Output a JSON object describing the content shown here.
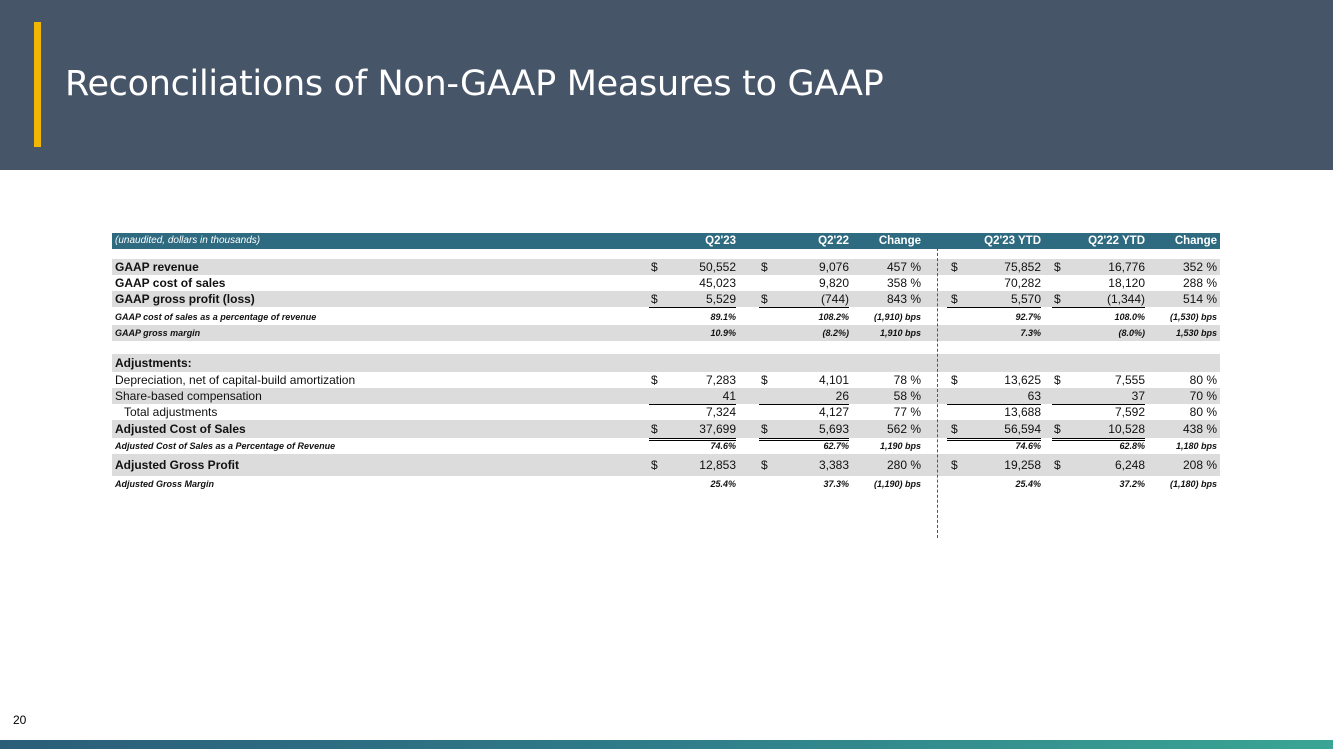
{
  "slide": {
    "title": "Reconciliations of Non-GAAP Measures to GAAP",
    "page_number": "20"
  },
  "table": {
    "note": "(unaudited, dollars in thousands)",
    "headers": [
      "Q2'23",
      "Q2'22",
      "Change",
      "Q2'23 YTD",
      "Q2'22 YTD",
      "Change"
    ],
    "gaap_revenue": {
      "label": "GAAP revenue",
      "d1": "$",
      "q223": "50,552",
      "d2": "$",
      "q222": "9,076",
      "chg": "457 %",
      "d3": "$",
      "ytd23": "75,852",
      "d4": "$",
      "ytd22": "16,776",
      "chg_ytd": "352 %"
    },
    "gaap_cost": {
      "label": "GAAP cost of sales",
      "q223": "45,023",
      "q222": "9,820",
      "chg": "358 %",
      "ytd23": "70,282",
      "ytd22": "18,120",
      "chg_ytd": "288 %"
    },
    "gaap_gp": {
      "label": "GAAP gross profit (loss)",
      "d1": "$",
      "q223": "5,529",
      "d2": "$",
      "q222": "(744)",
      "chg": "843 %",
      "d3": "$",
      "ytd23": "5,570",
      "d4": "$",
      "ytd22": "(1,344)",
      "chg_ytd": "514 %"
    },
    "gaap_cost_pct": {
      "label": "GAAP cost of sales as a percentage of revenue",
      "q223": "89.1%",
      "q222": "108.2%",
      "chg": "(1,910) bps",
      "ytd23": "92.7%",
      "ytd22": "108.0%",
      "chg_ytd": "(1,530) bps"
    },
    "gaap_gm": {
      "label": "GAAP gross margin",
      "q223": "10.9%",
      "q222": "(8.2%)",
      "chg": "1,910  bps",
      "ytd23": "7.3%",
      "ytd22": "(8.0%)",
      "chg_ytd": "1,530  bps"
    },
    "adjustments_label": "Adjustments:",
    "depreciation": {
      "label": "Depreciation, net of capital-build amortization",
      "d1": "$",
      "q223": "7,283",
      "d2": "$",
      "q222": "4,101",
      "chg": "78 %",
      "d3": "$",
      "ytd23": "13,625",
      "d4": "$",
      "ytd22": "7,555",
      "chg_ytd": "80 %"
    },
    "sbc": {
      "label": "Share-based compensation",
      "q223": "41",
      "q222": "26",
      "chg": "58 %",
      "ytd23": "63",
      "ytd22": "37",
      "chg_ytd": "70 %"
    },
    "total_adj": {
      "label": "Total adjustments",
      "q223": "7,324",
      "q222": "4,127",
      "chg": "77 %",
      "ytd23": "13,688",
      "ytd22": "7,592",
      "chg_ytd": "80 %"
    },
    "adj_cost": {
      "label": "Adjusted Cost of Sales",
      "d1": "$",
      "q223": "37,699",
      "d2": "$",
      "q222": "5,693",
      "chg": "562 %",
      "d3": "$",
      "ytd23": "56,594",
      "d4": "$",
      "ytd22": "10,528",
      "chg_ytd": "438 %"
    },
    "adj_cost_pct": {
      "label": "Adjusted Cost of Sales as a Percentage of Revenue",
      "q223": "74.6%",
      "q222": "62.7%",
      "chg": "1,190  bps",
      "ytd23": "74.6%",
      "ytd22": "62.8%",
      "chg_ytd": "1,180  bps"
    },
    "adj_gp": {
      "label": "Adjusted Gross Profit",
      "d1": "$",
      "q223": "12,853",
      "d2": "$",
      "q222": "3,383",
      "chg": "280 %",
      "d3": "$",
      "ytd23": "19,258",
      "d4": "$",
      "ytd22": "6,248",
      "chg_ytd": "208 %"
    },
    "adj_gm": {
      "label": "Adjusted Gross Margin",
      "q223": "25.4%",
      "q222": "37.3%",
      "chg": "(1,190) bps",
      "ytd23": "25.4%",
      "ytd22": "37.2%",
      "chg_ytd": "(1,180) bps"
    }
  }
}
